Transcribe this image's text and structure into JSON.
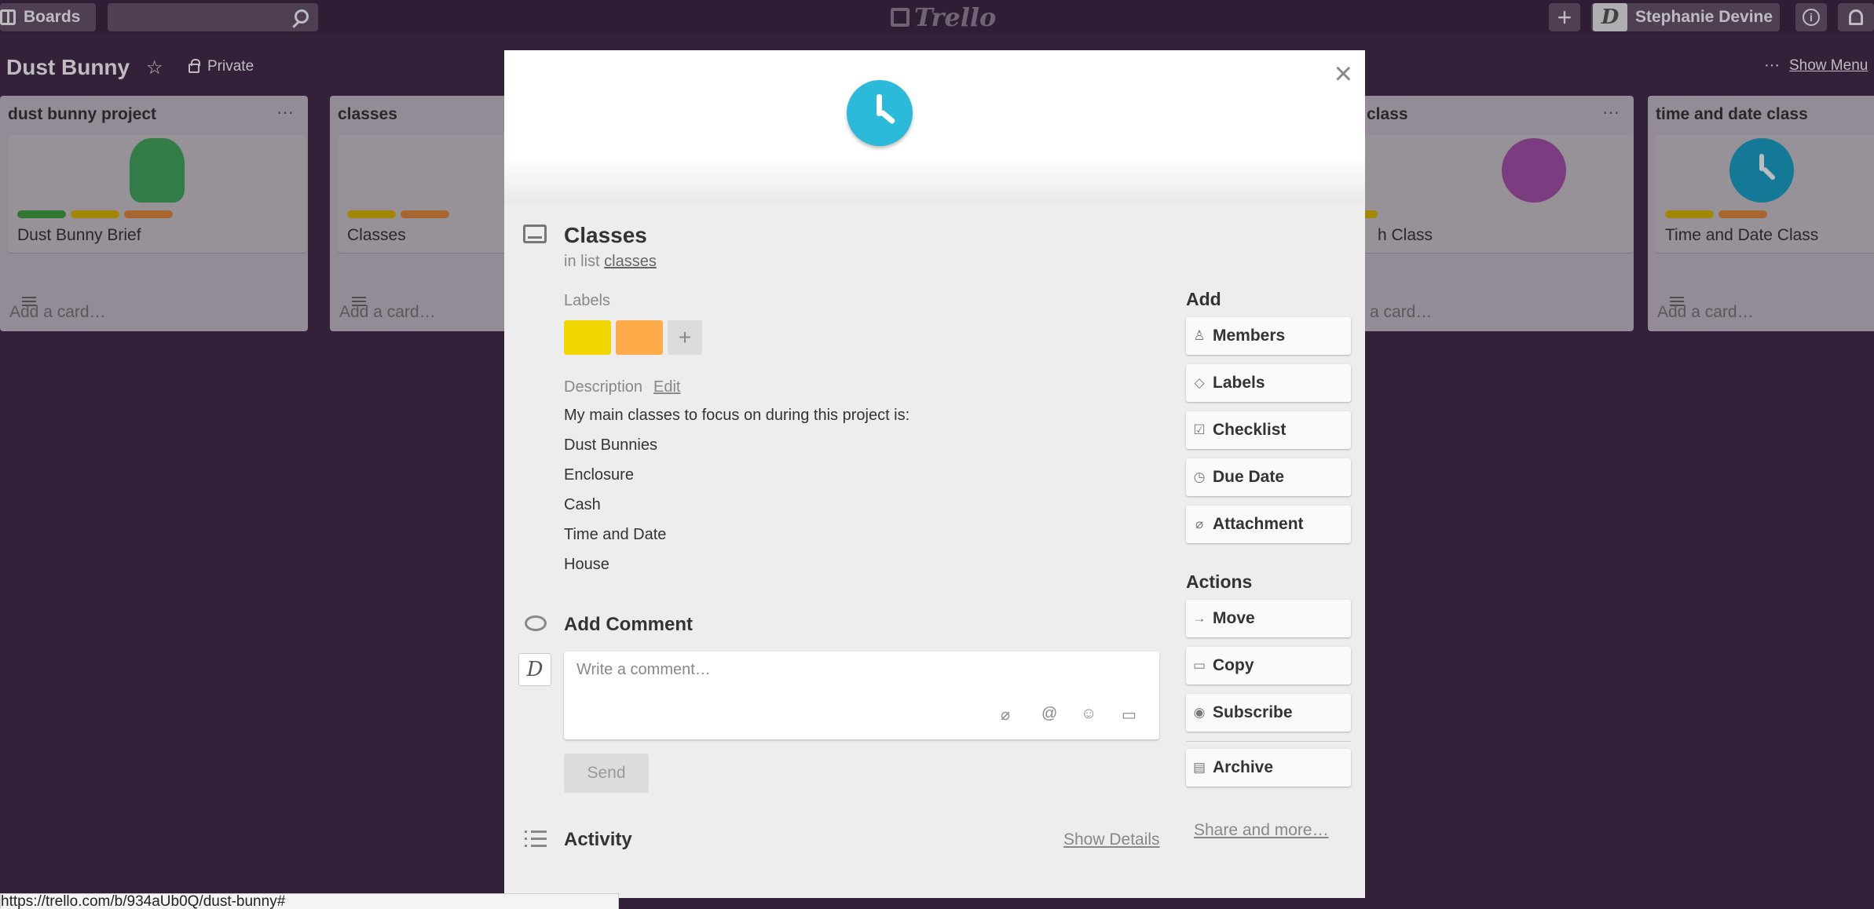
{
  "header": {
    "boards_label": "Boards",
    "logo": "Trello",
    "plus": "+",
    "user_name": "Stephanie Devine",
    "avatar_initial": "D",
    "info": "i"
  },
  "board": {
    "title": "Dust Bunny",
    "visibility": "Private",
    "show_menu": "Show Menu",
    "more": "···"
  },
  "lists": [
    {
      "title": "dust bunny project",
      "menu": "···",
      "card_title": "Dust Bunny Brief",
      "add_card": "Add a card…"
    },
    {
      "title": "classes",
      "menu": "···",
      "card_title": "Classes",
      "add_card": "Add a card…"
    },
    {
      "title": "class",
      "menu": "···",
      "card_title": "h Class",
      "add_card": "a card…"
    },
    {
      "title": "time and date class",
      "menu": "···",
      "card_title": "Time and Date Class",
      "add_card": "Add a card…"
    }
  ],
  "colors": {
    "background": "#3f2a47",
    "label_green": "#3fa33c",
    "label_yellow": "#f2d600",
    "label_orange": "#ffab4a",
    "cover_blue": "#2bbad9",
    "cover_purple": "#b04fb0"
  },
  "modal": {
    "close": "×",
    "title": "Classes",
    "in_list_prefix": "in list",
    "list_link": "classes",
    "labels_heading": "Labels",
    "label_add": "+",
    "description_heading": "Description",
    "edit": "Edit",
    "description_lines": [
      "My main classes to focus on during this project is:",
      "Dust Bunnies",
      "Enclosure",
      "Cash",
      "Time and Date",
      "House"
    ],
    "add_comment_heading": "Add Comment",
    "comment_avatar": "D",
    "comment_placeholder": "Write a comment…",
    "send": "Send",
    "activity_heading": "Activity",
    "show_details": "Show Details",
    "share_more": "Share and more…",
    "add_heading": "Add",
    "add_buttons": [
      "Members",
      "Labels",
      "Checklist",
      "Due Date",
      "Attachment"
    ],
    "actions_heading": "Actions",
    "action_buttons": [
      "Move",
      "Copy",
      "Subscribe",
      "Archive"
    ]
  },
  "status_bar": "https://trello.com/b/934aUb0Q/dust-bunny#"
}
